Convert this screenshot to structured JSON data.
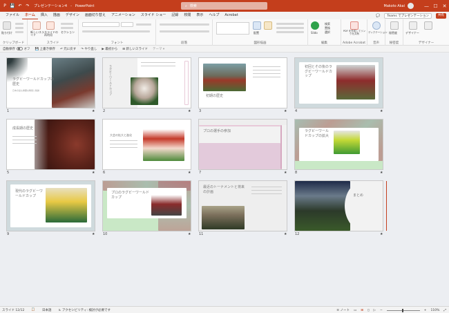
{
  "titlebar": {
    "doc_title": "プレゼンテーション4",
    "app_name": "PowerPoint",
    "search_placeholder": "検索",
    "user_name": "Makoto Akai",
    "minimize": "—",
    "maximize": "☐",
    "close": "✕"
  },
  "tabs": [
    "ファイル",
    "ホーム",
    "挿入",
    "描画",
    "デザイン",
    "画面切り替え",
    "アニメーション",
    "スライド ショー",
    "記録",
    "校閲",
    "表示",
    "ヘルプ",
    "Acrobat"
  ],
  "tabs_right": {
    "comment_label": "💬",
    "teams_label": "Teams でプレゼンテーション",
    "share_label": "共有"
  },
  "ribbon": {
    "groups": [
      "クリップボード",
      "スライド",
      "フォント",
      "段落",
      "図形描画",
      "Slido",
      "Adobe Acrobat",
      "音声",
      "秘密度",
      "デザイナー"
    ],
    "labels": {
      "paste": "貼り付け",
      "new_slide": "新しいスライド",
      "reuse_slide": "スライドの再利用",
      "section": "セクション",
      "arrange": "配置",
      "slido": "Slido",
      "find": "検索",
      "replace": "置換",
      "select": "選択",
      "pdf": "PDF を作成してリンクを共有",
      "dictate": "ディクテーション",
      "sensitivity": "秘密度",
      "designer": "デザイナー",
      "edit": "編集"
    }
  },
  "qat": {
    "autosave": "自動保存",
    "autosave_state": "オフ",
    "save": "上書き保存",
    "undo": "元に戻す",
    "redo": "やり直し",
    "from_start": "最初から",
    "new_slide": "新しいスライド",
    "layout": "テーマ"
  },
  "slides": [
    {
      "num": "1",
      "title": "ラグビーワールドカップの歴史",
      "subtitle": "日本の最も重要な瞬間と軌跡"
    },
    {
      "num": "2",
      "title": "ラグビーワールドカップ",
      "subtitle": ""
    },
    {
      "num": "3",
      "title": "初期の歴史",
      "subtitle": ""
    },
    {
      "num": "4",
      "title": "初回とその後のラグビーワールドカップ",
      "subtitle": ""
    },
    {
      "num": "5",
      "title": "成長期の歴史",
      "subtitle": ""
    },
    {
      "num": "6",
      "title": "大会の拡大と進化",
      "subtitle": ""
    },
    {
      "num": "7",
      "title": "プロの選手の参加",
      "subtitle": ""
    },
    {
      "num": "8",
      "title": "ラグビーワールドカップの拡大",
      "subtitle": ""
    },
    {
      "num": "9",
      "title": "現代のラグビーワールドカップ",
      "subtitle": ""
    },
    {
      "num": "10",
      "title": "プロのラグビーワールドカップ",
      "subtitle": ""
    },
    {
      "num": "11",
      "title": "最近のトーナメントと将来の計画",
      "subtitle": ""
    },
    {
      "num": "12",
      "title": "まとめ",
      "subtitle": ""
    }
  ],
  "statusbar": {
    "slide_info": "スライド 12/12",
    "language": "日本語",
    "accessibility": "アクセシビリティ: 検討が必要です",
    "notes": "ノート",
    "zoom": "110%",
    "zoom_fraction": 0.46
  },
  "colors": {
    "accent": "#c43e1c",
    "pink": "#e8c9d8",
    "green": "#c9e8c6"
  }
}
